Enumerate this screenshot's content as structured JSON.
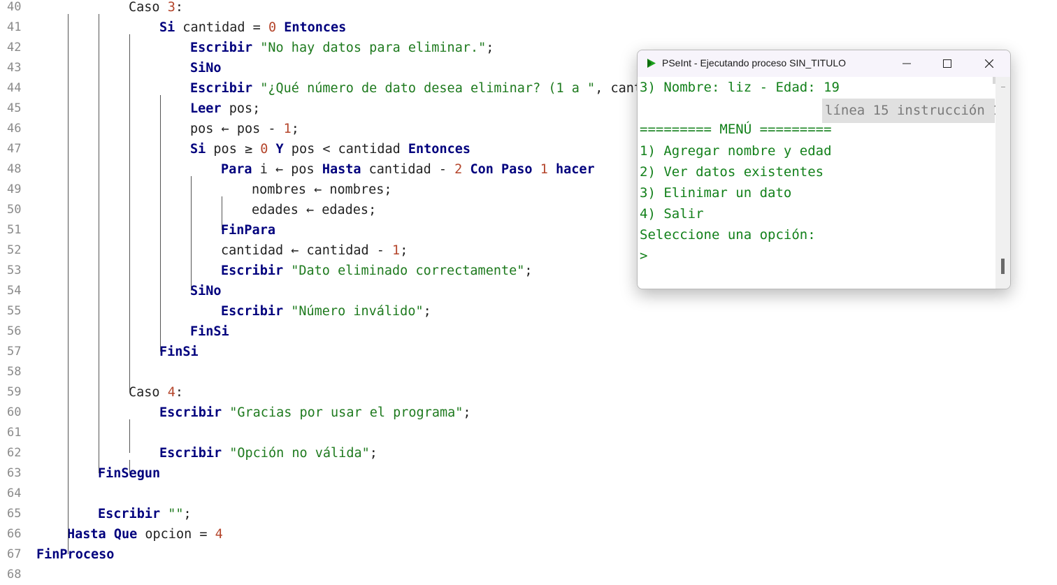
{
  "editor": {
    "lines": [
      {
        "n": "40",
        "t": [
          {
            "c": "id",
            "v": "Caso "
          },
          {
            "c": "num",
            "v": "3"
          },
          {
            "c": "id",
            "v": ":"
          }
        ]
      },
      {
        "n": "41",
        "t": [
          {
            "c": "kw",
            "v": "Si"
          },
          {
            "c": "id",
            "v": " cantidad = "
          },
          {
            "c": "num",
            "v": "0"
          },
          {
            "c": "id",
            "v": " "
          },
          {
            "c": "kw",
            "v": "Entonces"
          }
        ]
      },
      {
        "n": "42",
        "t": [
          {
            "c": "kw",
            "v": "Escribir"
          },
          {
            "c": "id",
            "v": " "
          },
          {
            "c": "str",
            "v": "\"No hay datos para eliminar.\""
          },
          {
            "c": "id",
            "v": ";"
          }
        ]
      },
      {
        "n": "43",
        "t": [
          {
            "c": "kw",
            "v": "SiNo"
          }
        ]
      },
      {
        "n": "44",
        "t": [
          {
            "c": "kw",
            "v": "Escribir"
          },
          {
            "c": "id",
            "v": " "
          },
          {
            "c": "str",
            "v": "\"¿Qué número de dato desea eliminar? (1 a \""
          },
          {
            "c": "id",
            "v": ", cant"
          }
        ]
      },
      {
        "n": "45",
        "t": [
          {
            "c": "kw",
            "v": "Leer"
          },
          {
            "c": "id",
            "v": " pos;"
          }
        ]
      },
      {
        "n": "46",
        "t": [
          {
            "c": "id",
            "v": "pos ← pos - "
          },
          {
            "c": "num",
            "v": "1"
          },
          {
            "c": "id",
            "v": ";"
          }
        ]
      },
      {
        "n": "47",
        "t": [
          {
            "c": "kw",
            "v": "Si"
          },
          {
            "c": "id",
            "v": " pos ≥ "
          },
          {
            "c": "num",
            "v": "0"
          },
          {
            "c": "id",
            "v": " "
          },
          {
            "c": "kw",
            "v": "Y"
          },
          {
            "c": "id",
            "v": " pos < cantidad "
          },
          {
            "c": "kw",
            "v": "Entonces"
          }
        ]
      },
      {
        "n": "48",
        "t": [
          {
            "c": "kw",
            "v": "Para"
          },
          {
            "c": "id",
            "v": " i ← pos "
          },
          {
            "c": "kw",
            "v": "Hasta"
          },
          {
            "c": "id",
            "v": " cantidad - "
          },
          {
            "c": "num",
            "v": "2"
          },
          {
            "c": "id",
            "v": " "
          },
          {
            "c": "kw",
            "v": "Con Paso"
          },
          {
            "c": "id",
            "v": " "
          },
          {
            "c": "num",
            "v": "1"
          },
          {
            "c": "id",
            "v": " "
          },
          {
            "c": "kw",
            "v": "hacer"
          }
        ]
      },
      {
        "n": "49",
        "t": [
          {
            "c": "id",
            "v": "nombres ← nombres;"
          }
        ]
      },
      {
        "n": "50",
        "t": [
          {
            "c": "id",
            "v": "edades ← edades;"
          }
        ]
      },
      {
        "n": "51",
        "t": [
          {
            "c": "kw",
            "v": "FinPara"
          }
        ]
      },
      {
        "n": "52",
        "t": [
          {
            "c": "id",
            "v": "cantidad ← cantidad - "
          },
          {
            "c": "num",
            "v": "1"
          },
          {
            "c": "id",
            "v": ";"
          }
        ]
      },
      {
        "n": "53",
        "t": [
          {
            "c": "kw",
            "v": "Escribir"
          },
          {
            "c": "id",
            "v": " "
          },
          {
            "c": "str",
            "v": "\"Dato eliminado correctamente\""
          },
          {
            "c": "id",
            "v": ";"
          }
        ]
      },
      {
        "n": "54",
        "t": [
          {
            "c": "kw",
            "v": "SiNo"
          }
        ]
      },
      {
        "n": "55",
        "t": [
          {
            "c": "kw",
            "v": "Escribir"
          },
          {
            "c": "id",
            "v": " "
          },
          {
            "c": "str",
            "v": "\"Número inválido\""
          },
          {
            "c": "id",
            "v": ";"
          }
        ]
      },
      {
        "n": "56",
        "t": [
          {
            "c": "kw",
            "v": "FinSi"
          }
        ]
      },
      {
        "n": "57",
        "t": [
          {
            "c": "kw",
            "v": "FinSi"
          }
        ]
      },
      {
        "n": "58",
        "t": []
      },
      {
        "n": "59",
        "t": [
          {
            "c": "id",
            "v": "Caso "
          },
          {
            "c": "num",
            "v": "4"
          },
          {
            "c": "id",
            "v": ":"
          }
        ]
      },
      {
        "n": "60",
        "t": [
          {
            "c": "kw",
            "v": "Escribir"
          },
          {
            "c": "id",
            "v": " "
          },
          {
            "c": "str",
            "v": "\"Gracias por usar el programa\""
          },
          {
            "c": "id",
            "v": ";"
          }
        ]
      },
      {
        "n": "61",
        "t": []
      },
      {
        "n": "62",
        "t": [
          {
            "c": "kw",
            "v": "Escribir"
          },
          {
            "c": "id",
            "v": " "
          },
          {
            "c": "str",
            "v": "\"Opción no válida\""
          },
          {
            "c": "id",
            "v": ";"
          }
        ]
      },
      {
        "n": "63",
        "t": [
          {
            "c": "kw",
            "v": "FinSegun"
          }
        ]
      },
      {
        "n": "64",
        "t": []
      },
      {
        "n": "65",
        "t": [
          {
            "c": "kw",
            "v": "Escribir"
          },
          {
            "c": "id",
            "v": " "
          },
          {
            "c": "str",
            "v": "\"\""
          },
          {
            "c": "id",
            "v": ";"
          }
        ]
      },
      {
        "n": "66",
        "t": [
          {
            "c": "kw",
            "v": "Hasta Que"
          },
          {
            "c": "id",
            "v": " opcion = "
          },
          {
            "c": "num",
            "v": "4"
          }
        ]
      },
      {
        "n": "67",
        "t": [
          {
            "c": "kw",
            "v": "FinProceso"
          }
        ]
      },
      {
        "n": "68",
        "t": []
      }
    ]
  },
  "console": {
    "title": "PSeInt - Ejecutando proceso SIN_TITULO",
    "status_tip": "línea 15 instrucción 1",
    "output": [
      "3) Nombre: liz - Edad: 19",
      "",
      "========= MENÚ =========",
      "1) Agregar nombre y edad",
      "2) Ver datos existentes",
      "3) Elinimar un dato",
      "4) Salir",
      "Seleccione una opción:",
      ">"
    ]
  },
  "icons": {
    "app": "pseint-logo-icon",
    "minimize": "minimize-icon",
    "maximize": "maximize-icon",
    "close": "close-icon"
  },
  "colors": {
    "keyword": "#00007d",
    "string": "#1e7a1e",
    "number": "#b4452b",
    "console_text": "#12801a"
  }
}
